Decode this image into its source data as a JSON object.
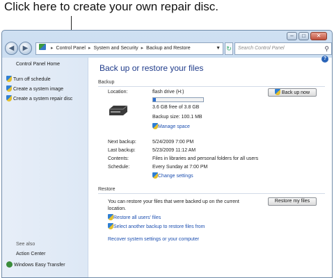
{
  "callout": "Click here to create your own repair disc.",
  "address": {
    "crumbs": [
      "Control Panel",
      "System and Security",
      "Backup and Restore"
    ],
    "search_placeholder": "Search Control Panel"
  },
  "sidebar": {
    "home": "Control Panel Home",
    "items": [
      {
        "label": "Turn off schedule"
      },
      {
        "label": "Create a system image"
      },
      {
        "label": "Create a system repair disc"
      }
    ],
    "see_also": "See also",
    "links": [
      {
        "label": "Action Center"
      },
      {
        "label": "Windows Easy Transfer"
      }
    ]
  },
  "main": {
    "title": "Back up or restore your files",
    "backup": {
      "header": "Backup",
      "location_label": "Location:",
      "location_value": "flash drive (H:)",
      "free_text": "3.6 GB free of 3.8 GB",
      "used_fraction": 0.05,
      "size_text": "Backup size: 100.1 MB",
      "manage_space": "Manage space",
      "back_up_now": "Back up now",
      "next_label": "Next backup:",
      "next_value": "5/24/2009 7:00 PM",
      "last_label": "Last backup:",
      "last_value": "5/23/2009 11:12 AM",
      "contents_label": "Contents:",
      "contents_value": "Files in libraries and personal folders for all users",
      "schedule_label": "Schedule:",
      "schedule_value": "Every Sunday at 7:00 PM",
      "change_settings": "Change settings"
    },
    "restore": {
      "header": "Restore",
      "description_line1": "You can restore your files that were backed up on the current",
      "description_line2": "location.",
      "restore_my_files": "Restore my files",
      "restore_all_users": "Restore all users' files",
      "select_another": "Select another backup to restore files from",
      "recover_settings": "Recover system settings or your computer"
    }
  },
  "colors": {
    "title_blue": "#1f3b8a",
    "link_blue": "#1c4fb0",
    "progress_fill": "#2d6fd1",
    "sidebar_bg": "#e7eef8"
  },
  "icons": [
    "shield-icon",
    "back-arrow-icon",
    "forward-arrow-icon",
    "refresh-icon",
    "search-icon",
    "help-icon",
    "drive-icon"
  ]
}
